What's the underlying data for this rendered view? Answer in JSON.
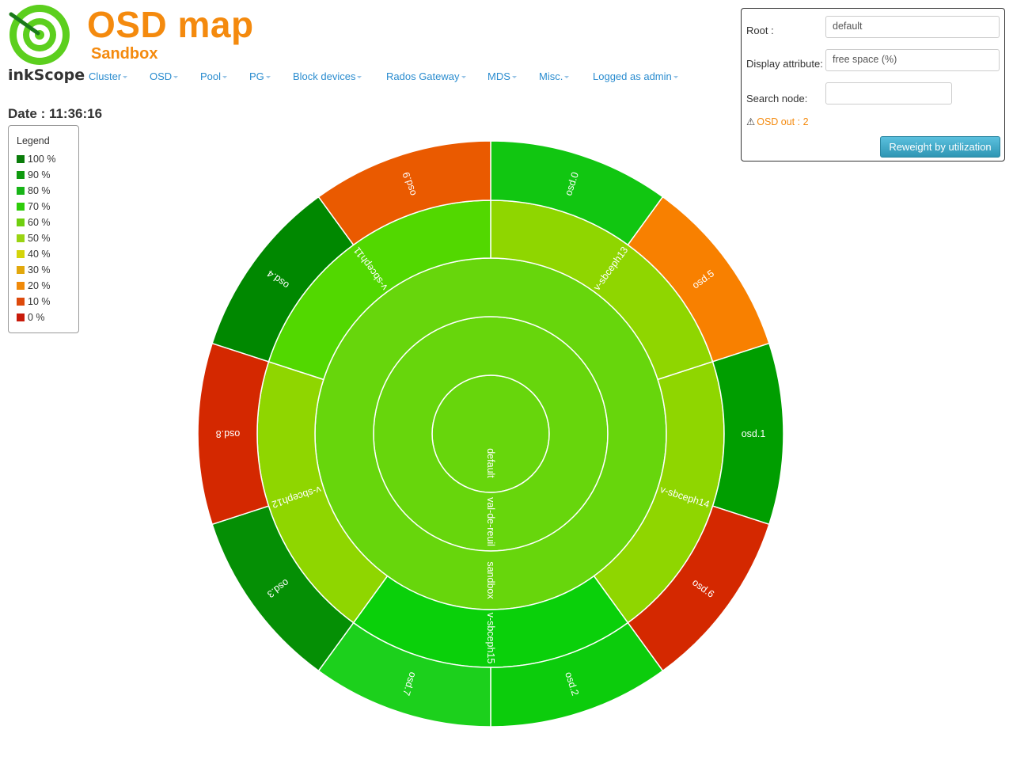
{
  "app": {
    "title": "OSD map",
    "subtitle": "Sandbox",
    "logo_text": "inkScope"
  },
  "nav": [
    "Cluster",
    "OSD",
    "Pool",
    "PG",
    "Block devices",
    "Rados Gateway",
    "MDS",
    "Misc.",
    "Logged as admin"
  ],
  "date": "Date : 11:36:16",
  "legend": {
    "title": "Legend",
    "items": [
      {
        "label": "100 %",
        "color": "#0a7c0a"
      },
      {
        "label": "90 %",
        "color": "#0f9a0f"
      },
      {
        "label": "80 %",
        "color": "#17b417"
      },
      {
        "label": "70 %",
        "color": "#2ecc0a"
      },
      {
        "label": "60 %",
        "color": "#6fcf0f"
      },
      {
        "label": "50 %",
        "color": "#9ad412"
      },
      {
        "label": "40 %",
        "color": "#d4d40a"
      },
      {
        "label": "30 %",
        "color": "#e2a80c"
      },
      {
        "label": "20 %",
        "color": "#f08a0a"
      },
      {
        "label": "10 %",
        "color": "#dd4a0c"
      },
      {
        "label": "0 %",
        "color": "#c81a0a"
      }
    ]
  },
  "controls": {
    "root_label": "Root :",
    "root_value": "default",
    "display_label": "Display attribute:",
    "display_value": "free space (%)",
    "search_label": "Search node:",
    "search_value": "",
    "osd_out": "OSD out : 2",
    "button": "Reweight by utilization"
  },
  "sunburst": {
    "root": {
      "name": "default",
      "color": "#67d60c"
    },
    "datacenter": {
      "name": "val-de-reuil",
      "color": "#67d60c"
    },
    "room": {
      "name": "sandbox",
      "color": "#67d60c"
    },
    "hosts": [
      {
        "name": "v-sbceph13",
        "color": "#8fd600",
        "osds": [
          {
            "name": "osd.0",
            "color": "#11c611"
          },
          {
            "name": "osd.5",
            "color": "#f88000"
          }
        ]
      },
      {
        "name": "v-sbceph14",
        "color": "#8fd600",
        "osds": [
          {
            "name": "osd.1",
            "color": "#009e00"
          },
          {
            "name": "osd.6",
            "color": "#d42800"
          }
        ]
      },
      {
        "name": "v-sbceph15",
        "color": "#0ad00a",
        "osds": [
          {
            "name": "osd.2",
            "color": "#0ccc0c"
          },
          {
            "name": "osd.7",
            "color": "#1cd01c"
          }
        ]
      },
      {
        "name": "v-sbceph12",
        "color": "#8fd600",
        "osds": [
          {
            "name": "osd.3",
            "color": "#058f05"
          },
          {
            "name": "osd.8",
            "color": "#d42800"
          }
        ]
      },
      {
        "name": "v-sbceph11",
        "color": "#52d800",
        "osds": [
          {
            "name": "osd.4",
            "color": "#008800"
          },
          {
            "name": "osd.9",
            "color": "#ea5a00"
          }
        ]
      }
    ]
  }
}
